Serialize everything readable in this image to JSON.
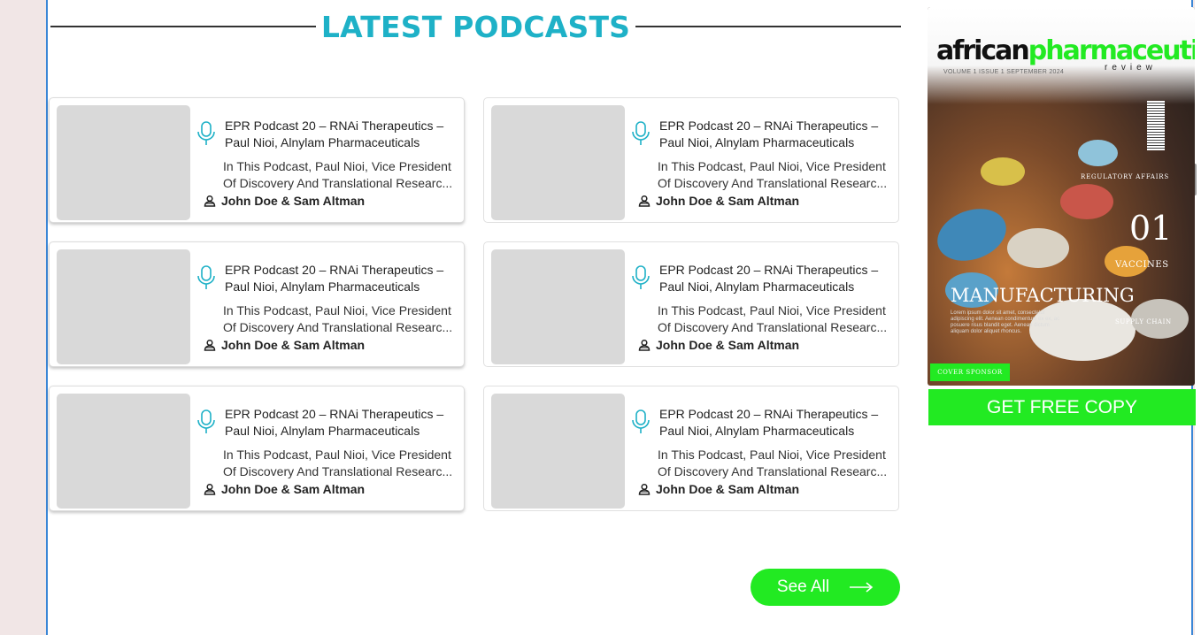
{
  "section": {
    "title": "LATEST PODCASTS"
  },
  "podcasts": [
    {
      "title": "EPR Podcast 20 – RNAi Therapeutics – Paul Nioi, Alnylam Pharmaceuticals",
      "desc_line1": "In This Podcast, Paul Nioi, Vice President",
      "desc_line2": "Of Discovery And Translational Researc...",
      "authors": "John Doe & Sam Altman"
    },
    {
      "title": "EPR Podcast 20 – RNAi Therapeutics – Paul Nioi, Alnylam Pharmaceuticals",
      "desc_line1": "In This Podcast, Paul Nioi, Vice President",
      "desc_line2": "Of Discovery And Translational Researc...",
      "authors": "John Doe & Sam Altman"
    },
    {
      "title": "EPR Podcast 20 – RNAi Therapeutics – Paul Nioi, Alnylam Pharmaceuticals",
      "desc_line1": "In This Podcast, Paul Nioi, Vice President",
      "desc_line2": "Of Discovery And Translational Researc...",
      "authors": "John Doe & Sam Altman"
    },
    {
      "title": "EPR Podcast 20 – RNAi Therapeutics – Paul Nioi, Alnylam Pharmaceuticals",
      "desc_line1": "In This Podcast, Paul Nioi, Vice President",
      "desc_line2": "Of Discovery And Translational Researc...",
      "authors": "John Doe & Sam Altman"
    },
    {
      "title": "EPR Podcast 20 – RNAi Therapeutics – Paul Nioi, Alnylam Pharmaceuticals",
      "desc_line1": "In This Podcast, Paul Nioi, Vice President",
      "desc_line2": "Of Discovery And Translational Researc...",
      "authors": "John Doe & Sam Altman"
    },
    {
      "title": "EPR Podcast 20 – RNAi Therapeutics – Paul Nioi, Alnylam Pharmaceuticals",
      "desc_line1": "In This Podcast, Paul Nioi, Vice President",
      "desc_line2": "Of Discovery And Translational Researc...",
      "authors": "John Doe & Sam Altman"
    }
  ],
  "see_all": {
    "label": "See All"
  },
  "magazine": {
    "brand_part1": "african",
    "brand_part2": "pharmaceutical",
    "subtitle": "review",
    "volume": "VOLUME 1 ISSUE 1 SEPTEMBER 2024",
    "regulatory": "REGULATORY AFFAIRS",
    "issue_number": "01",
    "vaccines": "VACCINES",
    "manufacturing": "MANUFACTURING",
    "lorem_main": "Lorem ipsum dolor sit amet, consectetur adipiscing elit. Aenean condimentum ex ex, ac posuere risus blandit eget. Aenean dictum aliquam dolor aliquet rhoncus.",
    "supply_chain": "SUPPLY CHAIN",
    "cover_sponsor": "COVER SPONSOR"
  },
  "get_copy": {
    "label": "GET FREE COPY"
  },
  "colors": {
    "accent": "#1eb1c7",
    "cta_green": "#22ea22",
    "frame_blue": "#3a86d6"
  },
  "icons": {
    "podcast": "microphone-icon",
    "authors": "users-icon",
    "see_all": "arrow-right-icon"
  }
}
